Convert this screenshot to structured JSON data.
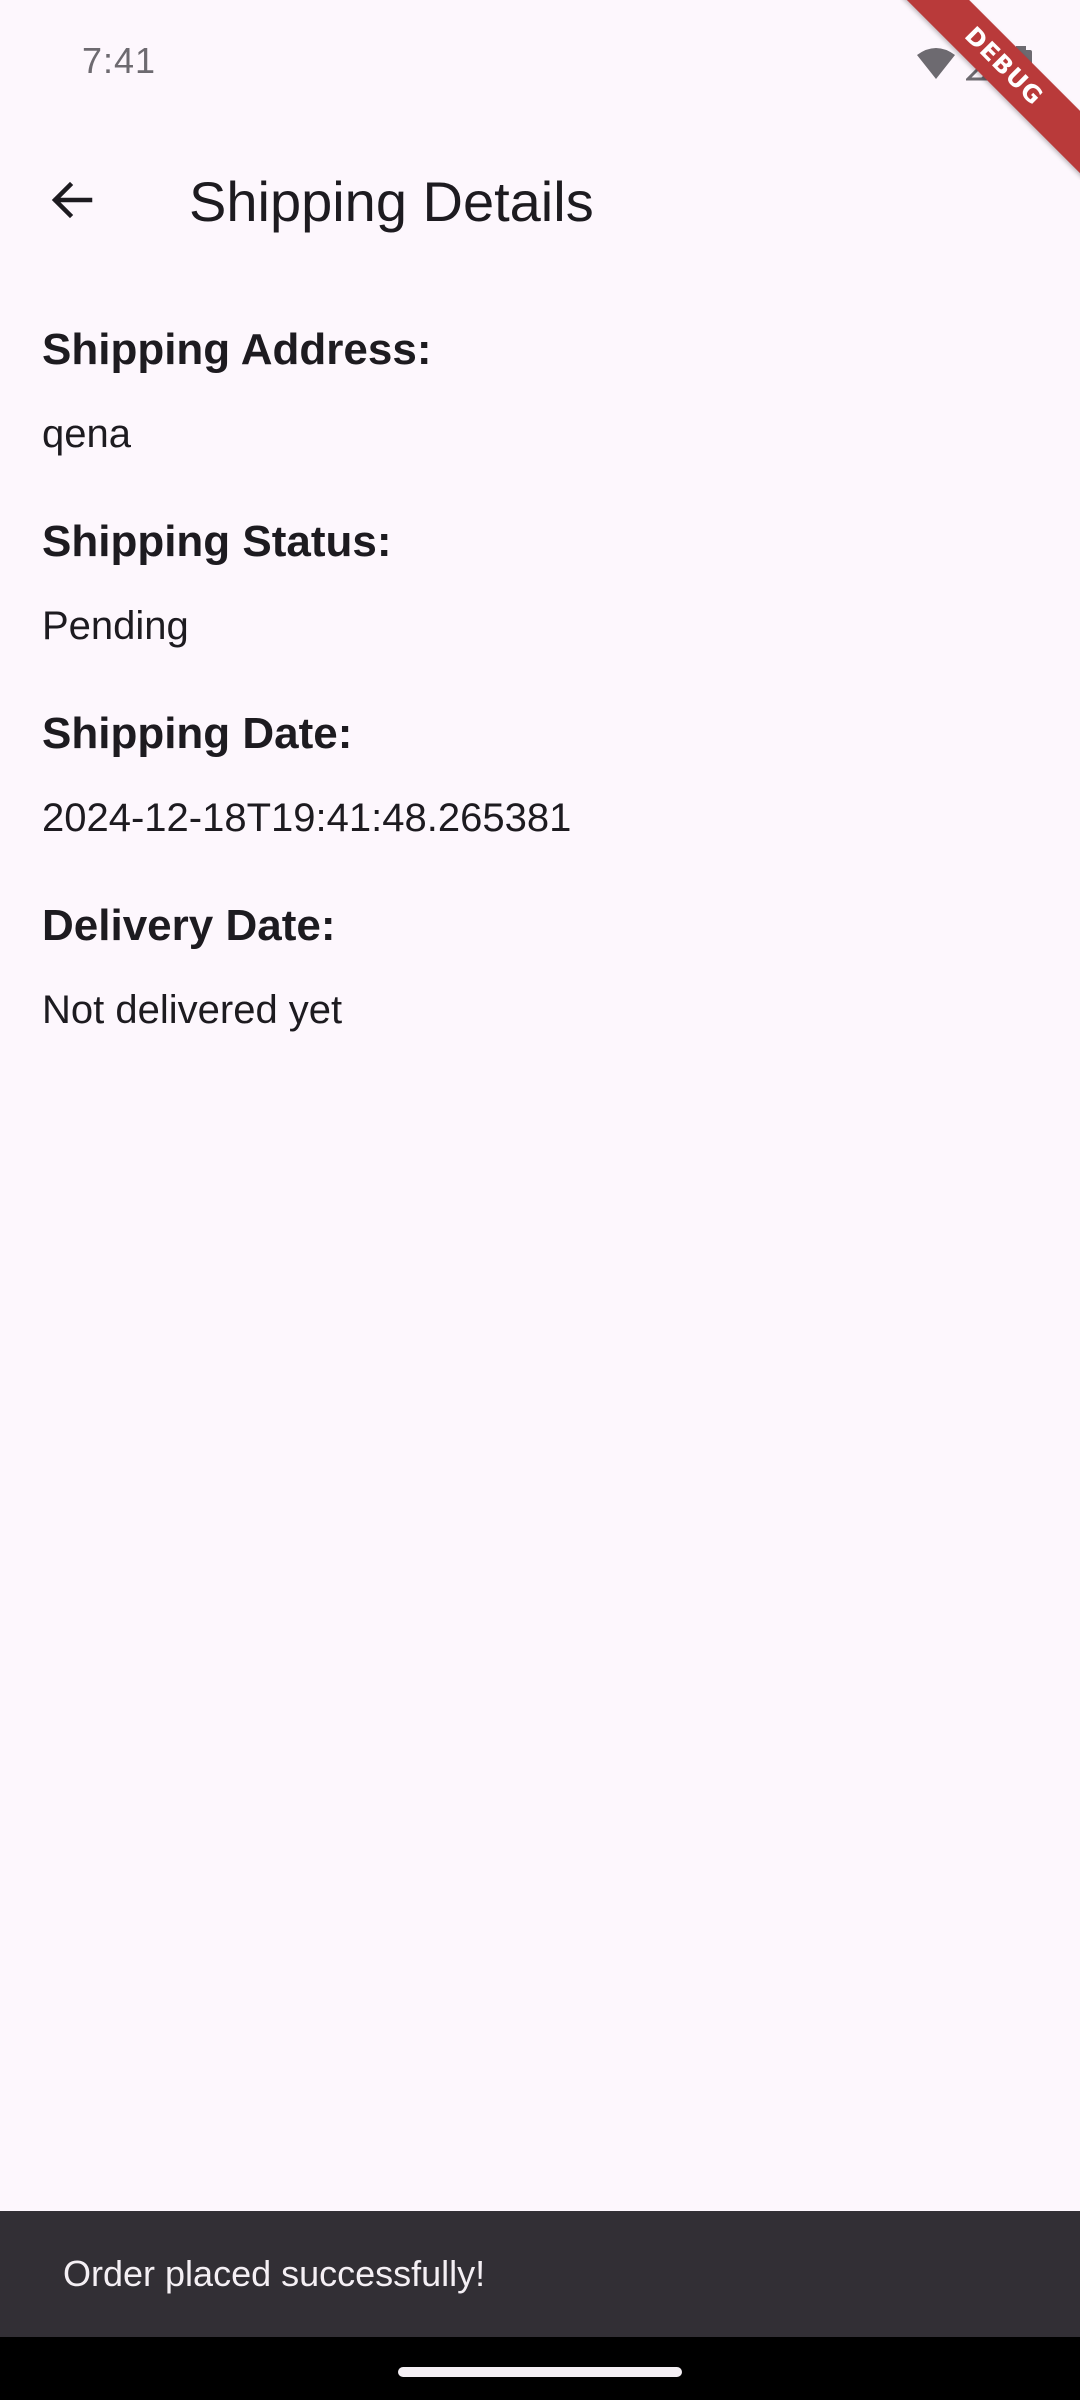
{
  "status_bar": {
    "time": "7:41",
    "icons": [
      "wifi-icon",
      "cellular-signal-icon",
      "battery-icon"
    ]
  },
  "debug_banner": {
    "label": "DEBUG",
    "color": "#b93a3a"
  },
  "app_bar": {
    "back_icon": "arrow-back-icon",
    "title": "Shipping Details"
  },
  "details": [
    {
      "label": "Shipping Address:",
      "value": "qena"
    },
    {
      "label": "Shipping Status:",
      "value": "Pending"
    },
    {
      "label": "Shipping Date:",
      "value": "2024-12-18T19:41:48.265381"
    },
    {
      "label": "Delivery Date:",
      "value": "Not delivered yet"
    }
  ],
  "snackbar": {
    "message": "Order placed successfully!"
  },
  "colors": {
    "background": "#fdf7fd",
    "text": "#1d1b20",
    "snackbar_bg": "#322f35",
    "snackbar_text": "#f4eff4"
  }
}
